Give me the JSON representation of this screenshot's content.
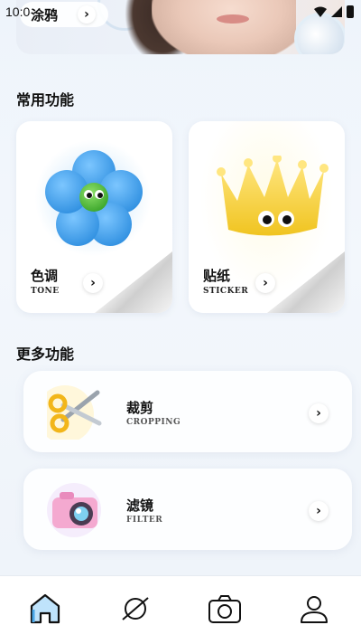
{
  "status_bar": {
    "time": "10:0"
  },
  "hero": {
    "label": "涂鸦"
  },
  "sections": {
    "common_title": "常用功能",
    "more_title": "更多功能"
  },
  "features": [
    {
      "title": "色调",
      "subtitle": "TONE",
      "icon": "blue-flower-icon"
    },
    {
      "title": "贴纸",
      "subtitle": "STICKER",
      "icon": "yellow-crown-icon"
    }
  ],
  "more_features": [
    {
      "title": "裁剪",
      "subtitle": "CROPPING",
      "icon": "scissors-icon"
    },
    {
      "title": "滤镜",
      "subtitle": "FILTER",
      "icon": "camera-icon"
    }
  ],
  "nav": [
    {
      "id": "home",
      "icon": "home-icon",
      "active": true
    },
    {
      "id": "explore",
      "icon": "planet-icon",
      "active": false
    },
    {
      "id": "camera",
      "icon": "camera-icon",
      "active": false
    },
    {
      "id": "profile",
      "icon": "profile-icon",
      "active": false
    }
  ],
  "colors": {
    "accent": "#4aa7e8",
    "background": "#eef4fb"
  }
}
